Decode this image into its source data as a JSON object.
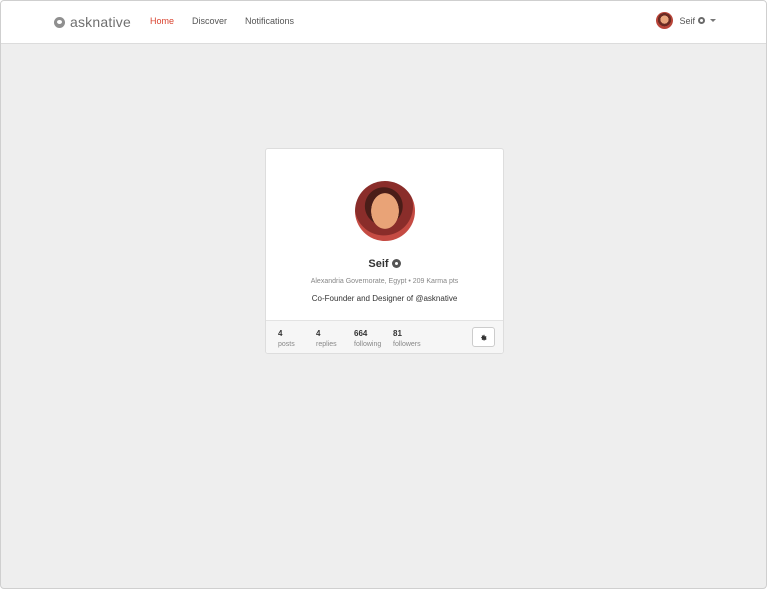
{
  "header": {
    "logo_text": "asknative",
    "nav": [
      {
        "label": "Home",
        "active": true
      },
      {
        "label": "Discover",
        "active": false
      },
      {
        "label": "Notifications",
        "active": false
      }
    ],
    "user": {
      "name": "Seif"
    }
  },
  "profile": {
    "name": "Seif",
    "location": "Alexandria Governorate, Egypt",
    "karma": "209 Karma pts",
    "meta_line": "Alexandria Governorate, Egypt • 209 Karma pts",
    "bio": "Co-Founder and Designer of @asknative",
    "stats": [
      {
        "value": "4",
        "label": "posts"
      },
      {
        "value": "4",
        "label": "replies"
      },
      {
        "value": "664",
        "label": "following"
      },
      {
        "value": "81",
        "label": "followers"
      }
    ]
  },
  "colors": {
    "accent": "#d9432f",
    "background": "#eeeeee"
  },
  "icons": {
    "settings": "gear-icon",
    "verified": "badge-icon",
    "dropdown": "chevron-down-icon"
  }
}
